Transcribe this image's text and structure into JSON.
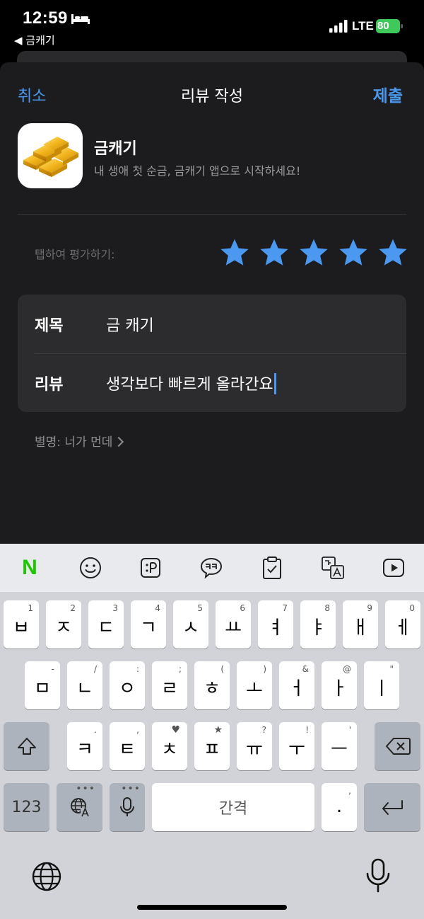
{
  "status_bar": {
    "time": "12:59",
    "back_app": "◀ 금캐기",
    "network": "LTE",
    "battery": "80"
  },
  "nav": {
    "cancel": "취소",
    "title": "리뷰 작성",
    "submit": "제출"
  },
  "app": {
    "name": "금캐기",
    "subtitle": "내 생애 첫 순금, 금캐기 앱으로 시작하세요!"
  },
  "rating": {
    "label": "탭하여 평가하기:",
    "stars_filled": 5,
    "stars_total": 5,
    "star_color": "#4a98f0"
  },
  "form": {
    "title_label": "제목",
    "title_value": "금 캐기",
    "review_label": "리뷰",
    "review_value": "생각보다 빠르게 올라간요"
  },
  "nickname": "별명: 너가 먼데",
  "keyboard": {
    "toolbar": [
      "naver-n-icon",
      "emoji-icon",
      "emoticon-text-icon",
      "kk-bubble-icon",
      "clipboard-icon",
      "translate-icon",
      "play-icon"
    ],
    "toolbar_n": "N",
    "row1": [
      {
        "k": "ㅂ",
        "h": "1"
      },
      {
        "k": "ㅈ",
        "h": "2"
      },
      {
        "k": "ㄷ",
        "h": "3"
      },
      {
        "k": "ㄱ",
        "h": "4"
      },
      {
        "k": "ㅅ",
        "h": "5"
      },
      {
        "k": "ㅛ",
        "h": "6"
      },
      {
        "k": "ㅕ",
        "h": "7"
      },
      {
        "k": "ㅑ",
        "h": "8"
      },
      {
        "k": "ㅐ",
        "h": "9"
      },
      {
        "k": "ㅔ",
        "h": "0"
      }
    ],
    "row2": [
      {
        "k": "ㅁ",
        "h": "-"
      },
      {
        "k": "ㄴ",
        "h": "/"
      },
      {
        "k": "ㅇ",
        "h": ":"
      },
      {
        "k": "ㄹ",
        "h": ";"
      },
      {
        "k": "ㅎ",
        "h": "("
      },
      {
        "k": "ㅗ",
        "h": ")"
      },
      {
        "k": "ㅓ",
        "h": "&"
      },
      {
        "k": "ㅏ",
        "h": "@"
      },
      {
        "k": "ㅣ",
        "h": "\""
      }
    ],
    "row3": [
      {
        "k": "ㅋ",
        "h": "."
      },
      {
        "k": "ㅌ",
        "h": ","
      },
      {
        "k": "ㅊ",
        "h": "♥"
      },
      {
        "k": "ㅍ",
        "h": "★"
      },
      {
        "k": "ㅠ",
        "h": "?"
      },
      {
        "k": "ㅜ",
        "h": "!"
      },
      {
        "k": "ㅡ",
        "h": "'"
      }
    ],
    "num_key": "123",
    "space_key": "간격",
    "period_key": ".",
    "period_hint": ","
  }
}
